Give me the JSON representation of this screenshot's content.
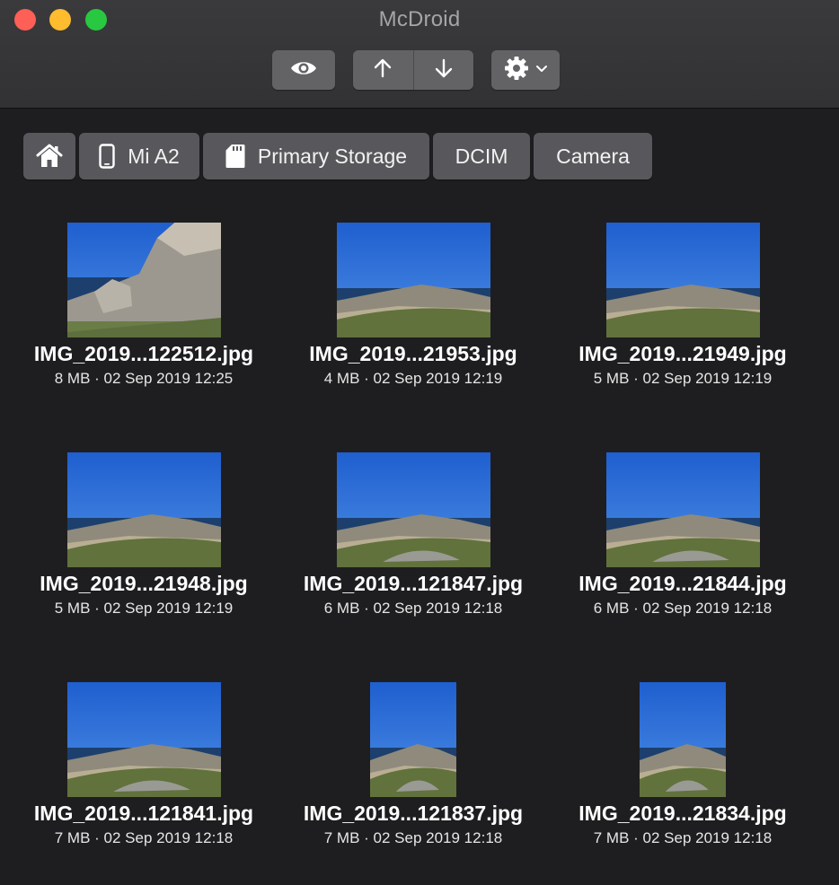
{
  "window": {
    "title": "McDroid"
  },
  "toolbar": {
    "preview": {
      "icon": "eye-icon"
    },
    "upload": {
      "icon": "arrow-up-icon"
    },
    "download": {
      "icon": "arrow-down-icon"
    },
    "settings": {
      "icon": "gear-icon",
      "dropdown_icon": "chevron-down-icon"
    }
  },
  "breadcrumb": [
    {
      "label": "",
      "icon": "home-icon"
    },
    {
      "label": "Mi A2",
      "icon": "phone-icon"
    },
    {
      "label": "Primary Storage",
      "icon": "sd-card-icon"
    },
    {
      "label": "DCIM"
    },
    {
      "label": "Camera"
    }
  ],
  "files": [
    {
      "name": "IMG_2019...122512.jpg",
      "meta": "8 MB · 02 Sep 2019 12:25"
    },
    {
      "name": "IMG_2019...21953.jpg",
      "meta": "4 MB · 02 Sep 2019 12:19"
    },
    {
      "name": "IMG_2019...21949.jpg",
      "meta": "5 MB · 02 Sep 2019 12:19"
    },
    {
      "name": "IMG_2019...21948.jpg",
      "meta": "5 MB · 02 Sep 2019 12:19"
    },
    {
      "name": "IMG_2019...121847.jpg",
      "meta": "6 MB · 02 Sep 2019 12:18"
    },
    {
      "name": "IMG_2019...21844.jpg",
      "meta": "6 MB · 02 Sep 2019 12:18"
    },
    {
      "name": "IMG_2019...121841.jpg",
      "meta": "7 MB · 02 Sep 2019 12:18"
    },
    {
      "name": "IMG_2019...121837.jpg",
      "meta": "7 MB · 02 Sep 2019 12:18"
    },
    {
      "name": "IMG_2019...21834.jpg",
      "meta": "7 MB · 02 Sep 2019 12:18"
    }
  ],
  "colors": {
    "background": "#1e1e20",
    "titlebar": "#353537",
    "button": "#636366",
    "crumb": "#58585c",
    "close": "#fe5f57",
    "minimize": "#febc2e",
    "zoom": "#28c840"
  }
}
